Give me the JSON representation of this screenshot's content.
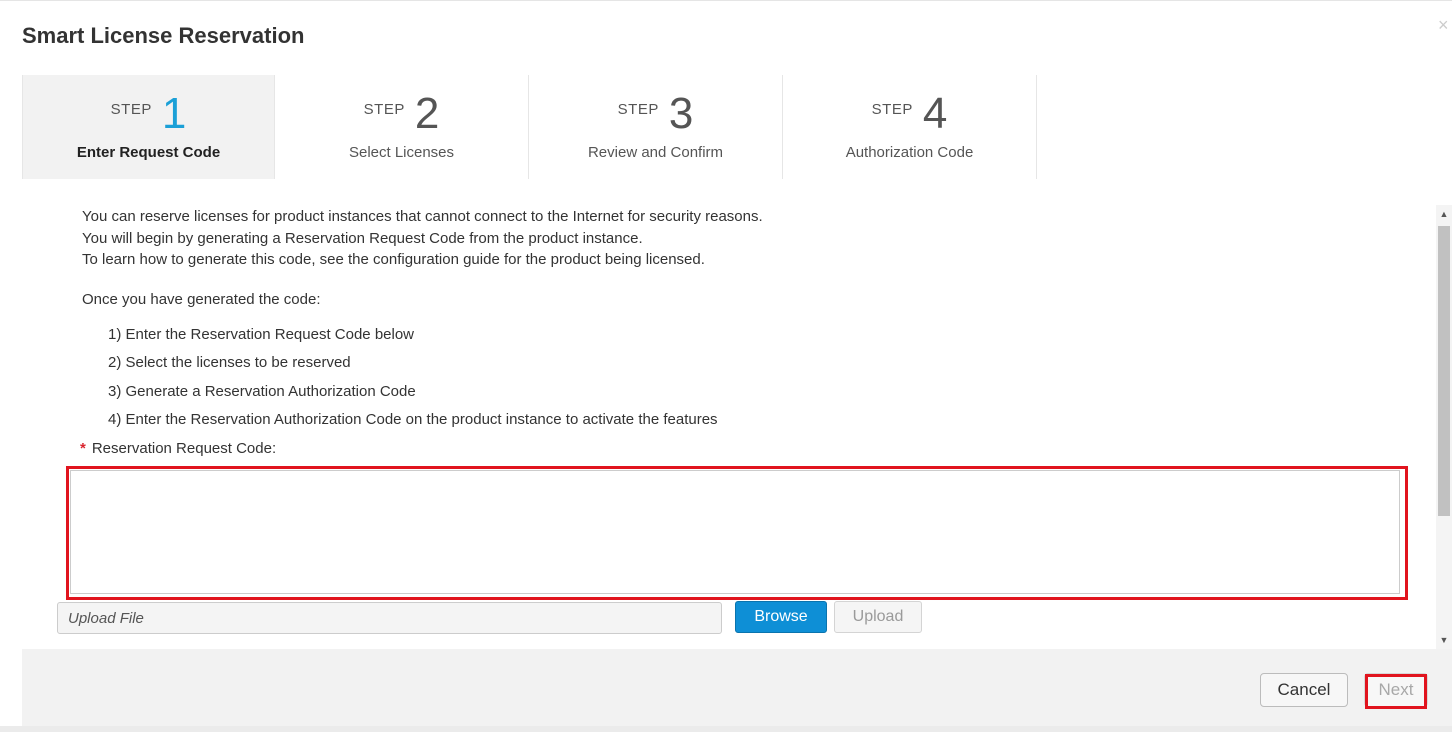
{
  "dialog": {
    "title": "Smart License Reservation",
    "close_glyph": "×"
  },
  "steps": [
    {
      "word": "STEP",
      "number": "1",
      "label": "Enter Request Code",
      "active": true
    },
    {
      "word": "STEP",
      "number": "2",
      "label": "Select Licenses",
      "active": false
    },
    {
      "word": "STEP",
      "number": "3",
      "label": "Review and Confirm",
      "active": false
    },
    {
      "word": "STEP",
      "number": "4",
      "label": "Authorization Code",
      "active": false
    }
  ],
  "intro": {
    "line1": "You can reserve licenses for product instances that cannot connect to the Internet for security reasons.",
    "line2": "You will begin by generating a Reservation Request Code from the product instance.",
    "line3": "To learn how to generate this code, see the configuration guide for the product being licensed."
  },
  "once_text": "Once you have generated the code:",
  "instructions": [
    "1) Enter the Reservation Request Code below",
    "2) Select the licenses to be reserved",
    "3) Generate a Reservation Authorization Code",
    "4) Enter the Reservation Authorization Code on the product instance to activate the features"
  ],
  "request_code": {
    "required_marker": "*",
    "label": "Reservation Request Code:",
    "value": ""
  },
  "upload": {
    "placeholder": "Upload File",
    "browse_label": "Browse",
    "upload_label": "Upload"
  },
  "footer": {
    "cancel_label": "Cancel",
    "next_label": "Next"
  },
  "colors": {
    "active_step_number": "#1ba0d7",
    "browse_button": "#0e8fd6",
    "highlight": "#e1141e",
    "required_star": "#d9242e"
  }
}
